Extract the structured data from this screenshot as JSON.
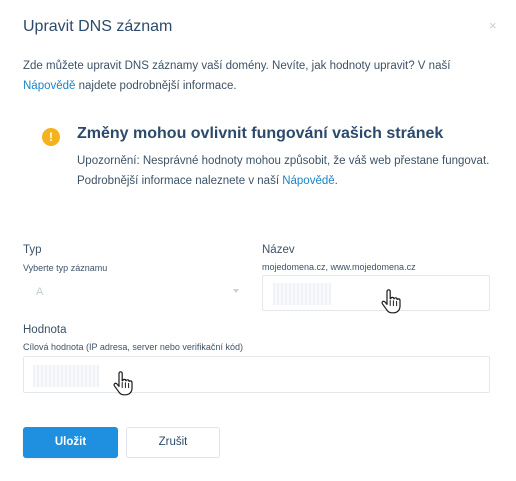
{
  "dialog": {
    "title": "Upravit DNS záznam",
    "close_glyph": "×"
  },
  "intro": {
    "text_before": "Zde můžete upravit DNS záznamy vaší domény. Nevíte, jak hodnoty upravit? V naší ",
    "link": "Nápovědě",
    "text_after": " najdete podrobnější informace."
  },
  "warning": {
    "icon": "warning-icon",
    "icon_glyph": "!",
    "title": "Změny mohou ovlivnit fungování vašich stránek",
    "text_before": "Upozornění: Nesprávné hodnoty mohou způsobit, že váš web přestane fungovat. Podrobnější informace naleznete v naší ",
    "link": "Nápovědě",
    "text_after": "."
  },
  "form": {
    "type": {
      "label": "Typ",
      "hint": "Vyberte typ záznamu",
      "value": "A"
    },
    "name": {
      "label": "Název",
      "hint": "mojedomena.cz, www.mojedomena.cz",
      "value": ""
    },
    "value": {
      "label": "Hodnota",
      "hint": "Cílová hodnota (IP adresa, server nebo verifikační kód)",
      "value": ""
    }
  },
  "buttons": {
    "save": "Uložit",
    "cancel": "Zrušit"
  },
  "colors": {
    "primary": "#1f8fe0",
    "link": "#1a84c7",
    "warning": "#f4b21c",
    "heading": "#2c4a6b"
  }
}
